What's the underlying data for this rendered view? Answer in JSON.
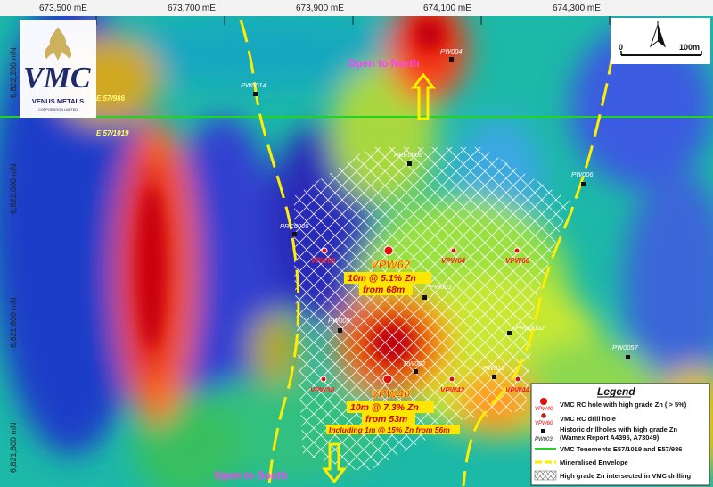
{
  "coords": {
    "x_labels": [
      "673,500 mE",
      "673,700 mE",
      "673,900 mE",
      "674,100 mE",
      "674,300 mE"
    ],
    "y_labels": [
      "6,822,200 mN",
      "6,822,000 mN",
      "6,821,800 mN",
      "6,821,600 mN"
    ]
  },
  "logo": {
    "name": "VENUS METALS",
    "sub": "CORPORATION LIMITED"
  },
  "scale": {
    "zero": "0",
    "length": "100m"
  },
  "tenements": {
    "north": "E  57/986",
    "south": "E  57/1019"
  },
  "open": {
    "north": "Open to North",
    "south": "Open to South"
  },
  "historic_holes": [
    "PW004",
    "PW0014",
    "PRE0006",
    "PW006",
    "PRC0005",
    "PW003",
    "PW009",
    "PRC0002",
    "PW0057",
    "PW002",
    "PW011"
  ],
  "vmc_holes": [
    "VPW60",
    "VPW64",
    "VPW66",
    "VPW38",
    "VPW42",
    "VPW44"
  ],
  "high_grade_holes": [
    "VPW62",
    "VPW40"
  ],
  "intercepts": {
    "vpw62_line1": "10m @ 5.1% Zn",
    "vpw62_line2": "from 68m",
    "vpw40_line1": "10m @ 7.3% Zn",
    "vpw40_line2": "from 53m",
    "vpw40_line3": "Including 1m @ 15% Zn from 56m"
  },
  "legend": {
    "title": "Legend",
    "items": [
      {
        "sym_label": "VPW40",
        "text": "VMC RC hole with high grade Zn ( > 5%)"
      },
      {
        "sym_label": "VPW60",
        "text": "VMC RC drill hole"
      },
      {
        "sym_label": "PW003",
        "text": "Historic drillholes with high grade Zn",
        "text2": "(Wamex Report A4395, A73049)"
      },
      {
        "text": "VMC Tenements E57/1019 and E57/986"
      },
      {
        "text": "Mineralised Envelope"
      },
      {
        "text": "High grade Zn intersected in VMC drilling"
      }
    ]
  },
  "colors": {
    "tenement_line": "#22d322",
    "envelope": "#ffee00",
    "high_grade_hole": "#e01010"
  }
}
